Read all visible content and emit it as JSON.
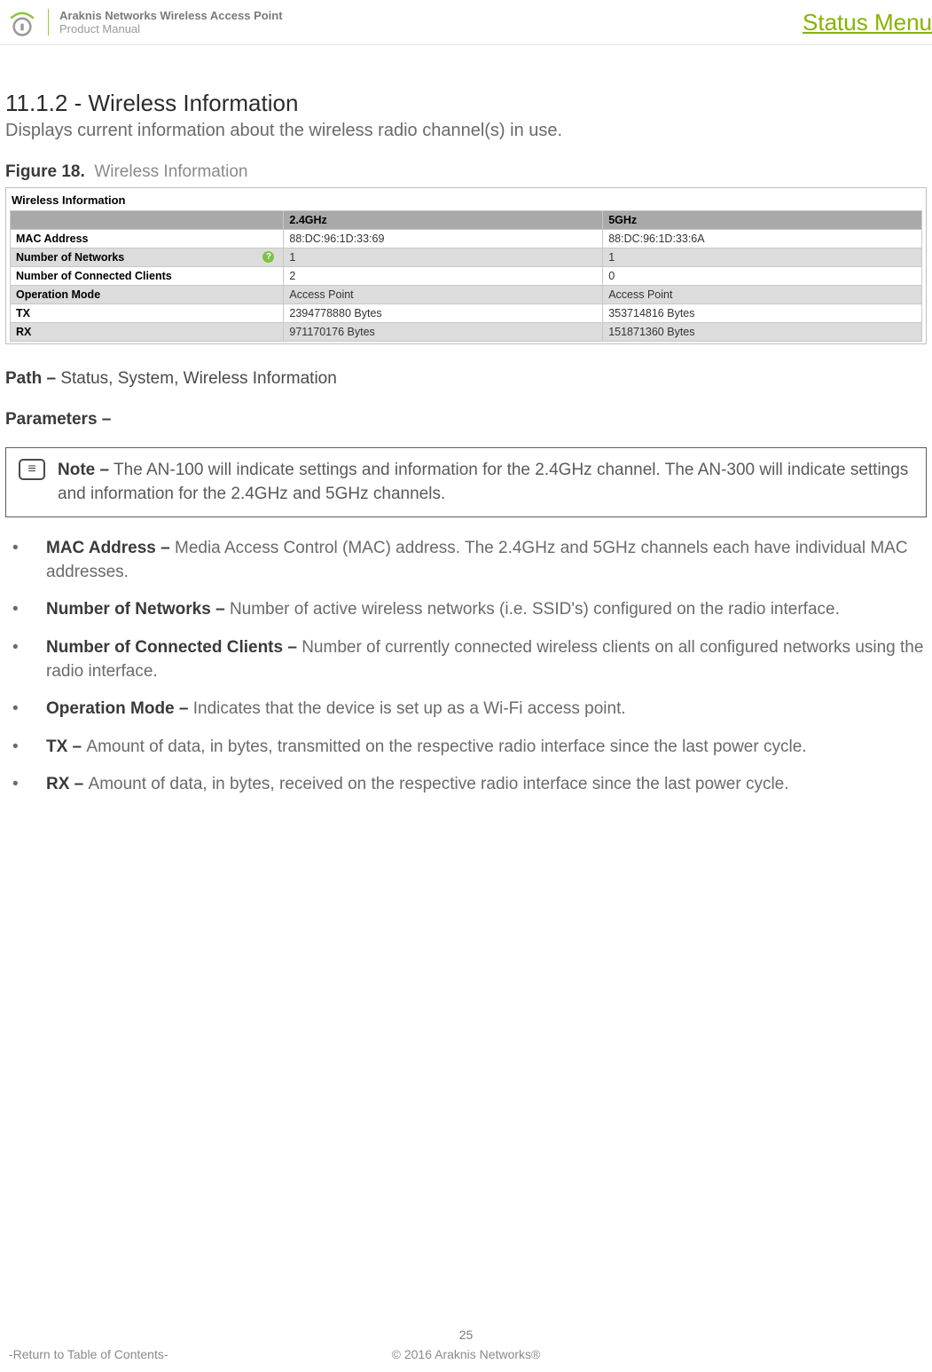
{
  "header": {
    "title_line1": "Araknis Networks Wireless Access Point",
    "title_line2": "Product Manual",
    "status_menu": "Status Menu"
  },
  "section": {
    "heading": "11.1.2 - Wireless Information",
    "subtitle": "Displays current information about the wireless radio channel(s) in use."
  },
  "figure": {
    "label": "Figure 18.",
    "title": "Wireless Information"
  },
  "screenshot": {
    "panel_title": "Wireless Information",
    "cols": {
      "c1": "2.4GHz",
      "c2": "5GHz"
    },
    "rows": [
      {
        "label": "MAC Address",
        "v1": "88:DC:96:1D:33:69",
        "v2": "88:DC:96:1D:33:6A",
        "help": false,
        "shade": "white"
      },
      {
        "label": "Number of Networks",
        "v1": "1",
        "v2": "1",
        "help": true,
        "shade": "grey"
      },
      {
        "label": "Number of Connected Clients",
        "v1": "2",
        "v2": "0",
        "help": false,
        "shade": "white"
      },
      {
        "label": "Operation Mode",
        "v1": "Access Point",
        "v2": "Access Point",
        "help": false,
        "shade": "grey"
      },
      {
        "label": "TX",
        "v1": "2394778880 Bytes",
        "v2": "353714816 Bytes",
        "help": false,
        "shade": "white"
      },
      {
        "label": "RX",
        "v1": "971170176 Bytes",
        "v2": "151871360 Bytes",
        "help": false,
        "shade": "grey"
      }
    ]
  },
  "path": {
    "label": "Path –",
    "value": "Status, System, Wireless Information"
  },
  "parameters_label": "Parameters –",
  "note": {
    "lead": "Note –",
    "text": "The AN-100 will indicate settings and information for the 2.4GHz channel. The AN-300 will indicate settings and information for the 2.4GHz and 5GHz channels."
  },
  "bullets": [
    {
      "term": "MAC Address –",
      "text": "Media Access Control (MAC) address. The 2.4GHz and 5GHz channels each have individual MAC addresses."
    },
    {
      "term": "Number of Networks –",
      "text": "Number of active wireless networks (i.e. SSID's) configured on the radio interface."
    },
    {
      "term": "Number of Connected Clients –",
      "text": "Number of currently connected wireless clients on all configured networks using the radio interface."
    },
    {
      "term": "Operation Mode –",
      "text": "Indicates that the device is set up as a Wi-Fi access point."
    },
    {
      "term": "TX –",
      "text": "Amount of data, in bytes, transmitted on the respective radio interface since the last power cycle."
    },
    {
      "term": "RX –",
      "text": "Amount of data, in bytes, received on the respective radio interface since the last power cycle."
    }
  ],
  "footer": {
    "page": "25",
    "toc": "-Return to Table of Contents-",
    "copyright": "© 2016 Araknis Networks®"
  }
}
